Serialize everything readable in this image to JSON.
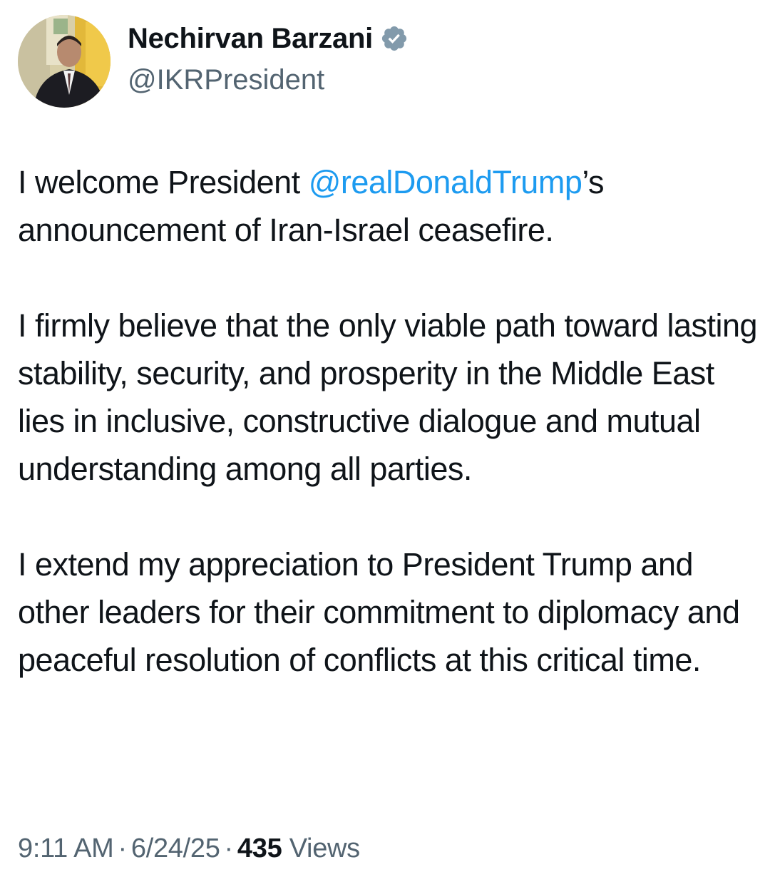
{
  "author": {
    "name": "Nechirvan Barzani",
    "handle": "@IKRPresident",
    "verified_icon": "verified-badge-icon",
    "verified_color": "#829aab"
  },
  "tweet": {
    "p1_before": "I welcome President ",
    "p1_mention": "@realDonaldTrump",
    "p1_after": "’s announcement of Iran-Israel ceasefire.",
    "p2": "I firmly believe that the only viable path toward lasting stability, security, and prosperity in the Middle East lies in inclusive, constructive dialogue and mutual understanding among all parties.",
    "p3": "I extend my appreciation to President Trump and other leaders for their commitment to diplomacy and peaceful resolution of conflicts at this critical time."
  },
  "meta": {
    "time": "9:11 AM",
    "separator": "·",
    "date": "6/24/25",
    "views_count": "435",
    "views_label": "Views"
  },
  "colors": {
    "text": "#0f1419",
    "secondary": "#536471",
    "link": "#1d9bf0"
  }
}
